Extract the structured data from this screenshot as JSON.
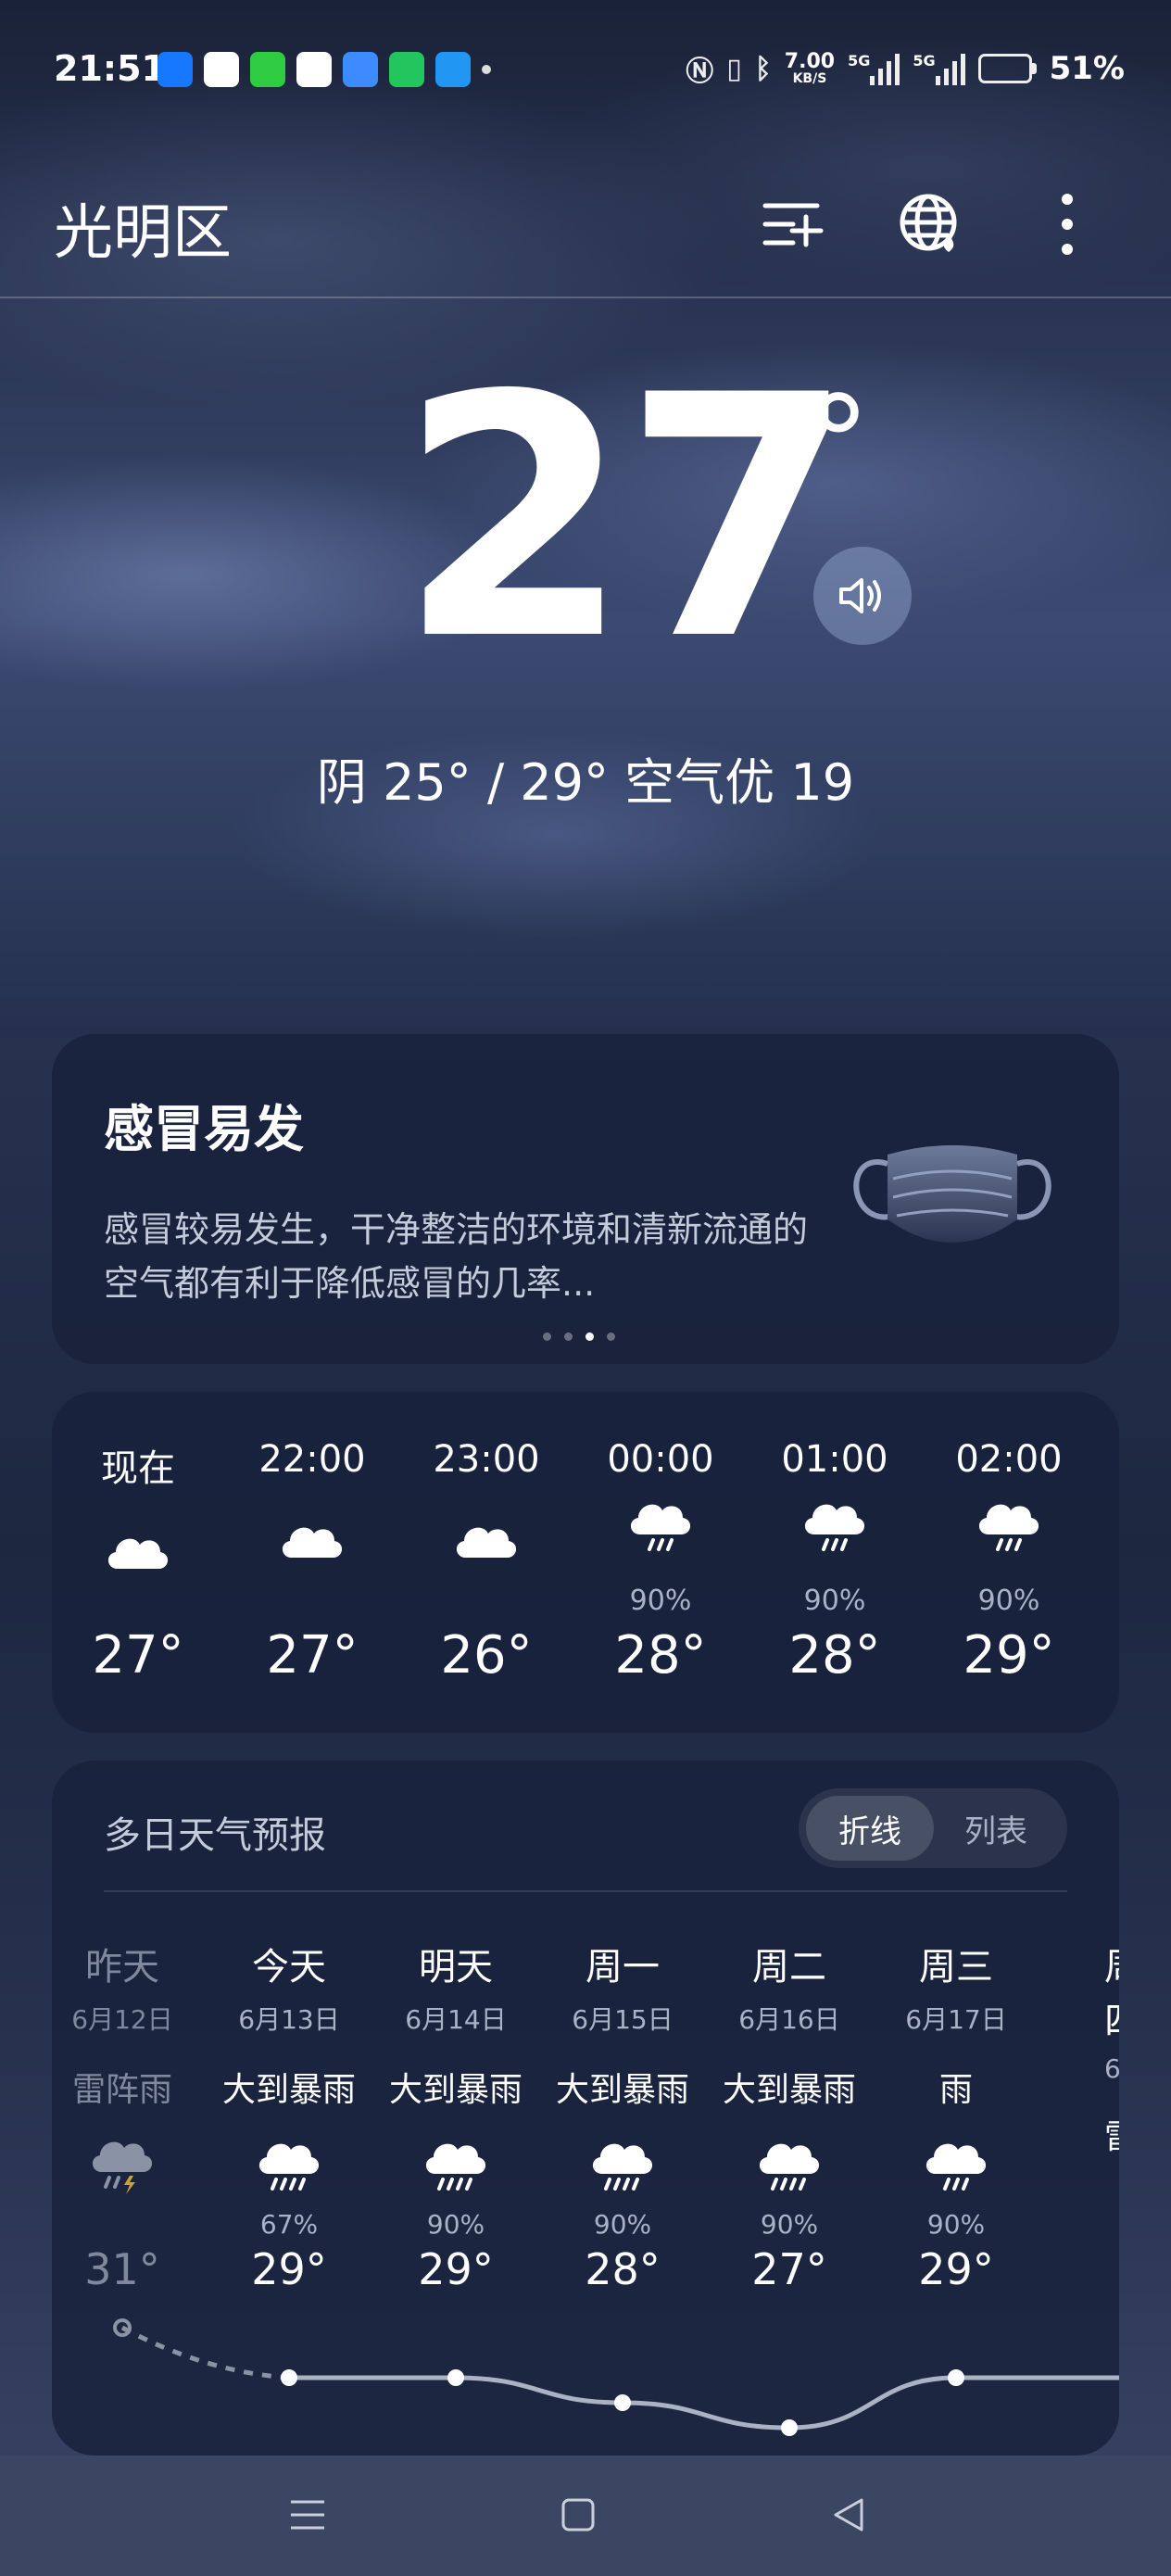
{
  "status_bar": {
    "time": "21:51",
    "network_speed": "7.00",
    "network_unit": "KB/S",
    "signal_1": "5G",
    "signal_2": "5G",
    "battery": "51%",
    "app_icon_colors": [
      "#1677ff",
      "#ffffff",
      "#2ecc40",
      "#ffffff",
      "#3d8bff",
      "#22c55e",
      "#2196f3"
    ]
  },
  "header": {
    "city": "光明区"
  },
  "current": {
    "temperature": "27",
    "degree": "°",
    "condition_line": "阴  25° / 29°  空气优 19"
  },
  "tip": {
    "title": "感冒易发",
    "text": "感冒较易发生，干净整洁的环境和清新流通的空气都有利于降低感冒的几率..."
  },
  "hourly": [
    {
      "time": "现在",
      "icon": "cloud-icon",
      "pct": "",
      "temp": "27°"
    },
    {
      "time": "22:00",
      "icon": "cloud-icon",
      "pct": "",
      "temp": "27°"
    },
    {
      "time": "23:00",
      "icon": "cloud-icon",
      "pct": "",
      "temp": "26°"
    },
    {
      "time": "00:00",
      "icon": "rain-icon",
      "pct": "90%",
      "temp": "28°"
    },
    {
      "time": "01:00",
      "icon": "rain-icon",
      "pct": "90%",
      "temp": "28°"
    },
    {
      "time": "02:00",
      "icon": "rain-icon",
      "pct": "90%",
      "temp": "29°"
    }
  ],
  "daily": {
    "title": "多日天气预报",
    "toggle_line": "折线",
    "toggle_list": "列表",
    "days": [
      {
        "name": "昨天",
        "date": "6月12日",
        "cond": "雷阵雨",
        "icon": "thunder-rain-icon",
        "pct": "",
        "temp": "31°",
        "high": 31
      },
      {
        "name": "今天",
        "date": "6月13日",
        "cond": "大到暴雨",
        "icon": "heavy-rain-icon",
        "pct": "67%",
        "temp": "29°",
        "high": 29
      },
      {
        "name": "明天",
        "date": "6月14日",
        "cond": "大到暴雨",
        "icon": "heavy-rain-icon",
        "pct": "90%",
        "temp": "29°",
        "high": 29
      },
      {
        "name": "周一",
        "date": "6月15日",
        "cond": "大到暴雨",
        "icon": "heavy-rain-icon",
        "pct": "90%",
        "temp": "28°",
        "high": 28
      },
      {
        "name": "周二",
        "date": "6月16日",
        "cond": "大到暴雨",
        "icon": "heavy-rain-icon",
        "pct": "90%",
        "temp": "27°",
        "high": 27
      },
      {
        "name": "周三",
        "date": "6月17日",
        "cond": "雨",
        "icon": "rain-icon",
        "pct": "90%",
        "temp": "29°",
        "high": 29
      },
      {
        "name": "周四",
        "date": "6",
        "cond": "雷",
        "icon": "",
        "pct": "",
        "temp": "",
        "high": 29
      }
    ]
  },
  "colors": {
    "battery_fill": "#2ecc40",
    "card_bg": "#18213a",
    "muted_text": "#a9b2c6"
  }
}
